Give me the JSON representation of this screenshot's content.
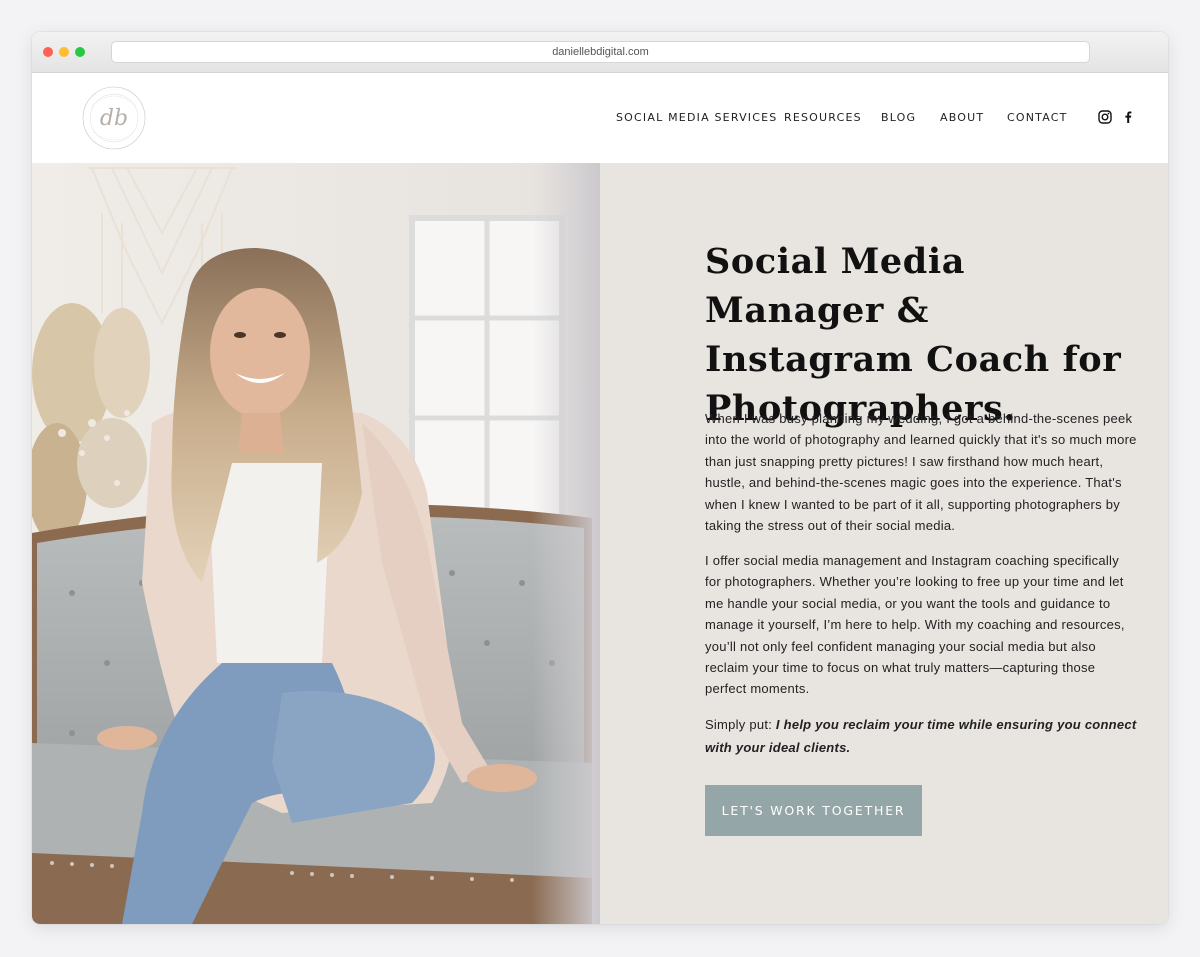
{
  "browser": {
    "url": "daniellebdigital.com"
  },
  "header": {
    "logo_text": "DANIELLE B DIGITAL",
    "logo_monogram": "db",
    "nav": [
      {
        "label": "SOCIAL MEDIA SERVICES"
      },
      {
        "label": "RESOURCES"
      },
      {
        "label": "BLOG"
      },
      {
        "label": "ABOUT"
      },
      {
        "label": "CONTACT"
      }
    ],
    "social_icons": [
      "instagram-icon",
      "facebook-icon"
    ]
  },
  "hero": {
    "headline": "Social Media Manager & Instagram Coach for Photographers.",
    "paragraph_1": "When I was busy planning my wedding, I got a behind-the-scenes peek into the world of photography and learned quickly that it's so much more than just snapping pretty pictures! I saw firsthand how much heart, hustle, and behind-the-scenes magic goes into the experience. That's when I knew I wanted to be part of it all, supporting photographers by taking the stress out of their social media.",
    "paragraph_2": "I offer social media management and Instagram coaching specifically for photographers. Whether you’re looking to free up your time and let me handle your social media, or you want the tools and guidance to manage it yourself, I’m here to help. With my coaching and resources, you’ll not only feel confident managing your social media but also reclaim your time to focus on what truly matters—capturing those perfect moments.",
    "paragraph_3_lead": "Simply put: ",
    "paragraph_3_emphasis": "I help you reclaim your time while ensuring you connect with your ideal clients.",
    "cta_label": "LET'S WORK TOGETHER"
  },
  "colors": {
    "content_background": "#e8e4e0",
    "cta_background": "#94a6a7",
    "text": "#111111"
  }
}
